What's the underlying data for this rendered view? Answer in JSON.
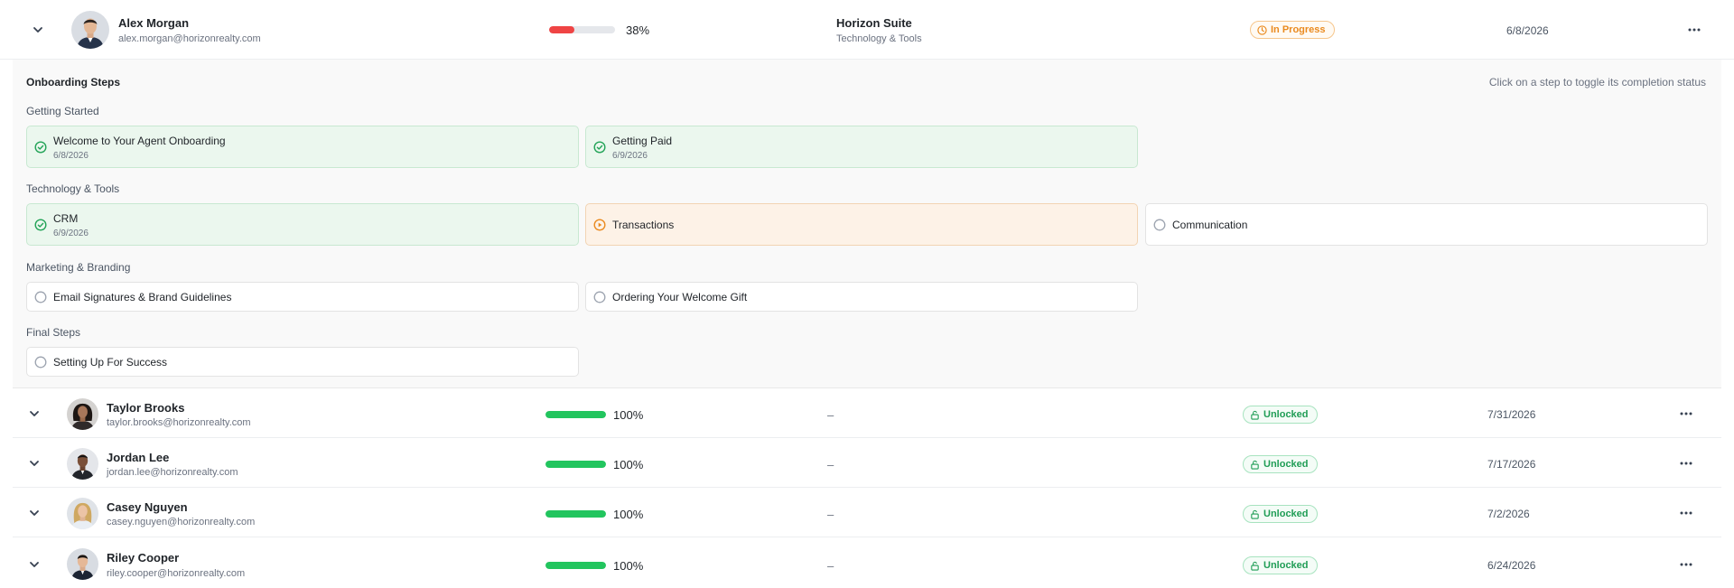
{
  "colors": {
    "progress_low": "#ef4444",
    "progress_full": "#22c55e",
    "in_progress": "#ea8a1f",
    "unlocked": "#1f9d55",
    "step_done_bg": "#ebf7ee",
    "step_active_bg": "#fdf2e7"
  },
  "icons": {
    "expand": "chevron-down-icon",
    "more": "more-horizontal-icon",
    "step_done": "check-circle-icon",
    "step_active": "play-circle-icon",
    "step_todo": "empty-circle-icon",
    "unlocked": "unlock-icon",
    "in_progress": "clock-icon"
  },
  "expanded_agent": {
    "name": "Alex Morgan",
    "email": "alex.morgan@horizonrealty.com",
    "progress": 38,
    "progress_label": "38%",
    "suite_title": "Horizon Suite",
    "suite_subtitle": "Technology & Tools",
    "status": "In Progress",
    "date": "6/8/2026"
  },
  "onboarding": {
    "title": "Onboarding Steps",
    "hint": "Click on a step to toggle its completion status",
    "groups": [
      {
        "label": "Getting Started",
        "steps": [
          {
            "title": "Welcome to Your Agent Onboarding",
            "date": "6/8/2026",
            "state": "done"
          },
          {
            "title": "Getting Paid",
            "date": "6/9/2026",
            "state": "done"
          }
        ]
      },
      {
        "label": "Technology & Tools",
        "steps": [
          {
            "title": "CRM",
            "date": "6/9/2026",
            "state": "done"
          },
          {
            "title": "Transactions",
            "state": "active"
          },
          {
            "title": "Communication",
            "state": "todo"
          }
        ]
      },
      {
        "label": "Marketing & Branding",
        "steps": [
          {
            "title": "Email Signatures & Brand Guidelines",
            "state": "todo"
          },
          {
            "title": "Ordering Your Welcome Gift",
            "state": "todo"
          }
        ]
      },
      {
        "label": "Final Steps",
        "steps": [
          {
            "title": "Setting Up For Success",
            "state": "todo"
          }
        ]
      }
    ]
  },
  "agents": [
    {
      "name": "Taylor Brooks",
      "email": "taylor.brooks@horizonrealty.com",
      "progress": 100,
      "progress_label": "100%",
      "suite": "–",
      "status": "Unlocked",
      "date": "7/31/2026"
    },
    {
      "name": "Jordan Lee",
      "email": "jordan.lee@horizonrealty.com",
      "progress": 100,
      "progress_label": "100%",
      "suite": "–",
      "status": "Unlocked",
      "date": "7/17/2026"
    },
    {
      "name": "Casey Nguyen",
      "email": "casey.nguyen@horizonrealty.com",
      "progress": 100,
      "progress_label": "100%",
      "suite": "–",
      "status": "Unlocked",
      "date": "7/2/2026"
    },
    {
      "name": "Riley Cooper",
      "email": "riley.cooper@horizonrealty.com",
      "progress": 100,
      "progress_label": "100%",
      "suite": "–",
      "status": "Unlocked",
      "date": "6/24/2026"
    }
  ]
}
